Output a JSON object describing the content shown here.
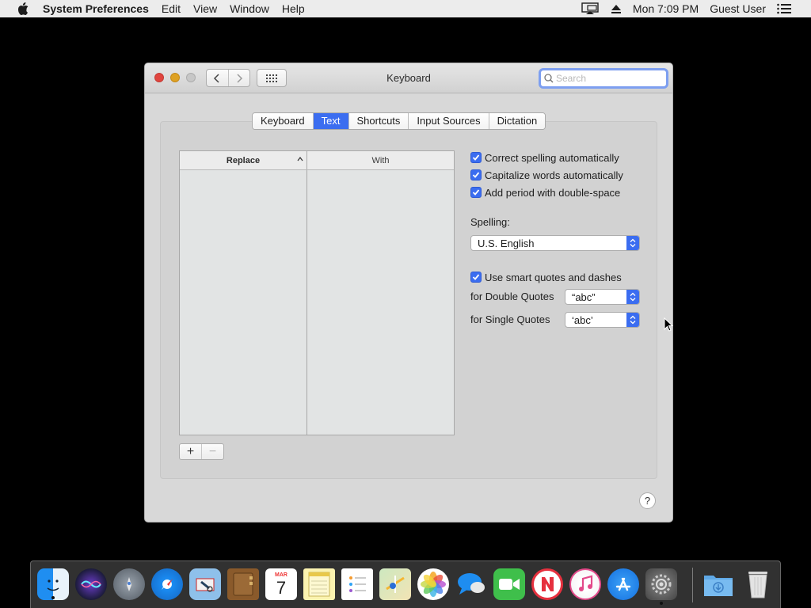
{
  "menubar": {
    "app_name": "System Preferences",
    "menus": [
      "Edit",
      "View",
      "Window",
      "Help"
    ],
    "clock": "Mon 7:09 PM",
    "user": "Guest User"
  },
  "window": {
    "title": "Keyboard",
    "search_placeholder": "Search"
  },
  "tabs": [
    {
      "label": "Keyboard",
      "active": false
    },
    {
      "label": "Text",
      "active": true
    },
    {
      "label": "Shortcuts",
      "active": false
    },
    {
      "label": "Input Sources",
      "active": false
    },
    {
      "label": "Dictation",
      "active": false
    }
  ],
  "table": {
    "columns": [
      "Replace",
      "With"
    ],
    "rows": []
  },
  "buttons": {
    "add": "+",
    "remove": "−",
    "help": "?"
  },
  "options": {
    "correct_spelling": {
      "label": "Correct spelling automatically",
      "checked": true
    },
    "capitalize_words": {
      "label": "Capitalize words automatically",
      "checked": true
    },
    "add_period": {
      "label": "Add period with double-space",
      "checked": true
    },
    "spelling_label": "Spelling:",
    "spelling_value": "U.S. English",
    "smart_quotes": {
      "label": "Use smart quotes and dashes",
      "checked": true
    },
    "double_quotes_label": "for Double Quotes",
    "double_quotes_value": "“abc”",
    "single_quotes_label": "for Single Quotes",
    "single_quotes_value": "‘abc’"
  },
  "colors": {
    "accent": "#3b6df0",
    "close": "#e0443e",
    "minimize": "#dea123"
  },
  "dock": {
    "items": [
      "finder-icon",
      "siri-icon",
      "launchpad-icon",
      "safari-icon",
      "mail-icon",
      "contacts-icon",
      "calendar-icon",
      "notes-icon",
      "reminders-icon",
      "maps-icon",
      "photos-icon",
      "messages-icon",
      "facetime-icon",
      "news-icon",
      "itunes-icon",
      "app-store-icon",
      "system-preferences-icon",
      "downloads-folder-icon",
      "trash-icon"
    ],
    "calendar_month": "MAR",
    "calendar_day": "7"
  }
}
